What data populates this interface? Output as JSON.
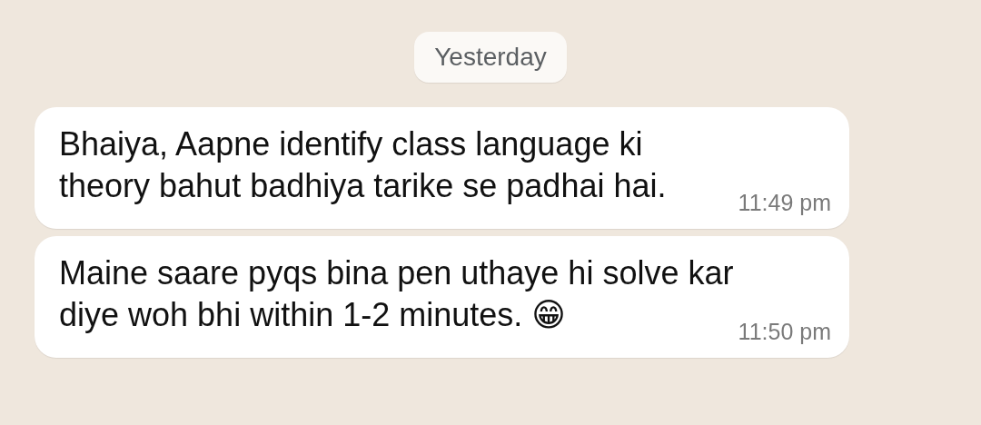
{
  "date_chip": "Yesterday",
  "messages": [
    {
      "text": "Bhaiya, Aapne identify class language ki\ntheory bahut badhiya tarike se padhai hai.",
      "time": "11:49 pm"
    },
    {
      "text": "Maine saare pyqs bina pen uthaye hi solve kar\ndiye woh bhi within 1-2 minutes. 😁",
      "time": "11:50 pm"
    }
  ]
}
